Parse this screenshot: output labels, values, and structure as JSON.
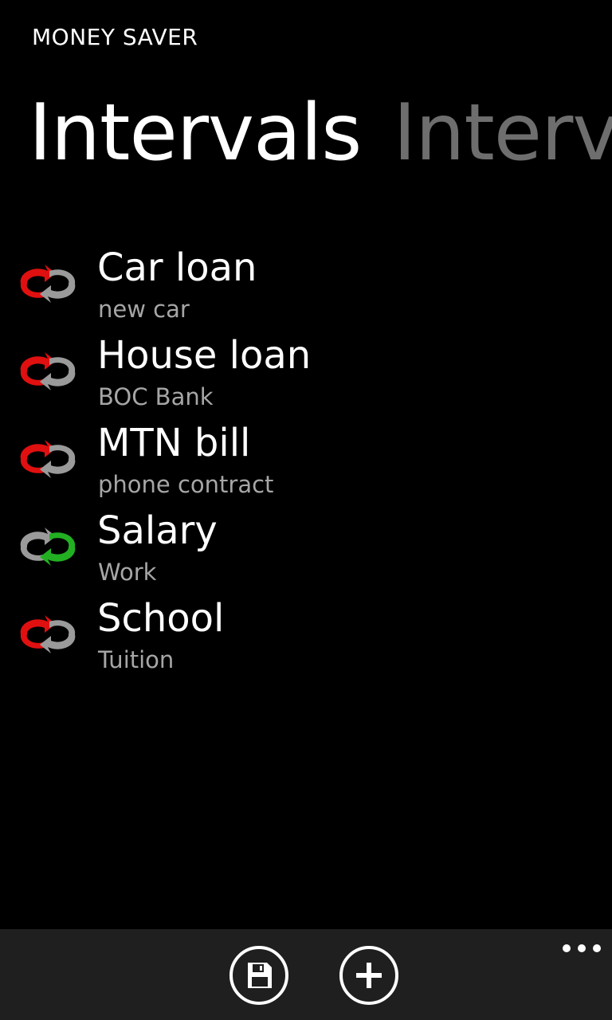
{
  "app": {
    "title": "MONEY SAVER"
  },
  "pivot": {
    "active": "Intervals",
    "next": "Intervals"
  },
  "intervals": [
    {
      "name": "Car loan",
      "subtitle": "new car",
      "icon": "expense-cycle-icon",
      "status": "red"
    },
    {
      "name": "House loan",
      "subtitle": "BOC Bank",
      "icon": "expense-cycle-icon",
      "status": "red"
    },
    {
      "name": "MTN bill",
      "subtitle": "phone contract",
      "icon": "expense-cycle-icon",
      "status": "red"
    },
    {
      "name": "Salary",
      "subtitle": "Work",
      "icon": "income-cycle-icon",
      "status": "green"
    },
    {
      "name": "School",
      "subtitle": "Tuition",
      "icon": "expense-cycle-icon",
      "status": "red"
    }
  ],
  "app_bar": {
    "buttons": [
      {
        "icon": "save-icon"
      },
      {
        "icon": "add-icon"
      }
    ],
    "more_icon": "more-icon"
  },
  "colors": {
    "background": "#000000",
    "app_bar": "#1f1f1f",
    "expense": "#e01010",
    "income": "#22b022",
    "neutral": "#9a9a9a",
    "subtitle": "#a6a6a6",
    "inactive_pivot": "#6e6e6e"
  }
}
